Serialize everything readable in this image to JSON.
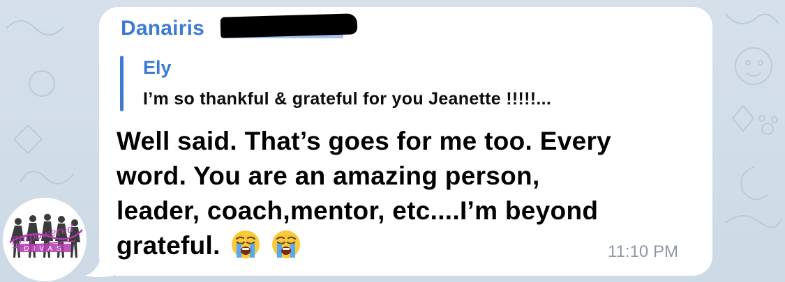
{
  "chat": {
    "background_color": "#cfdbe6",
    "bubble_color": "#ffffff",
    "accent_color": "#3d7ad6"
  },
  "message": {
    "sender_name": "Danairis",
    "sender_name_redacted": true,
    "reply": {
      "author": "Ely",
      "preview": "I’m so thankful & grateful for you Jeanette !!!!!..."
    },
    "lines": [
      "Well said. That’s goes for me too. Every",
      "word. You are an amazing person,",
      "leader, coach,mentor, etc....I’m beyond",
      "grateful."
    ],
    "emoji": [
      "loudly-crying-face",
      "loudly-crying-face"
    ],
    "time": "11:10 PM"
  },
  "avatar": {
    "logo_text_top": "Empowered",
    "logo_text_bottom": "DIVAS"
  }
}
